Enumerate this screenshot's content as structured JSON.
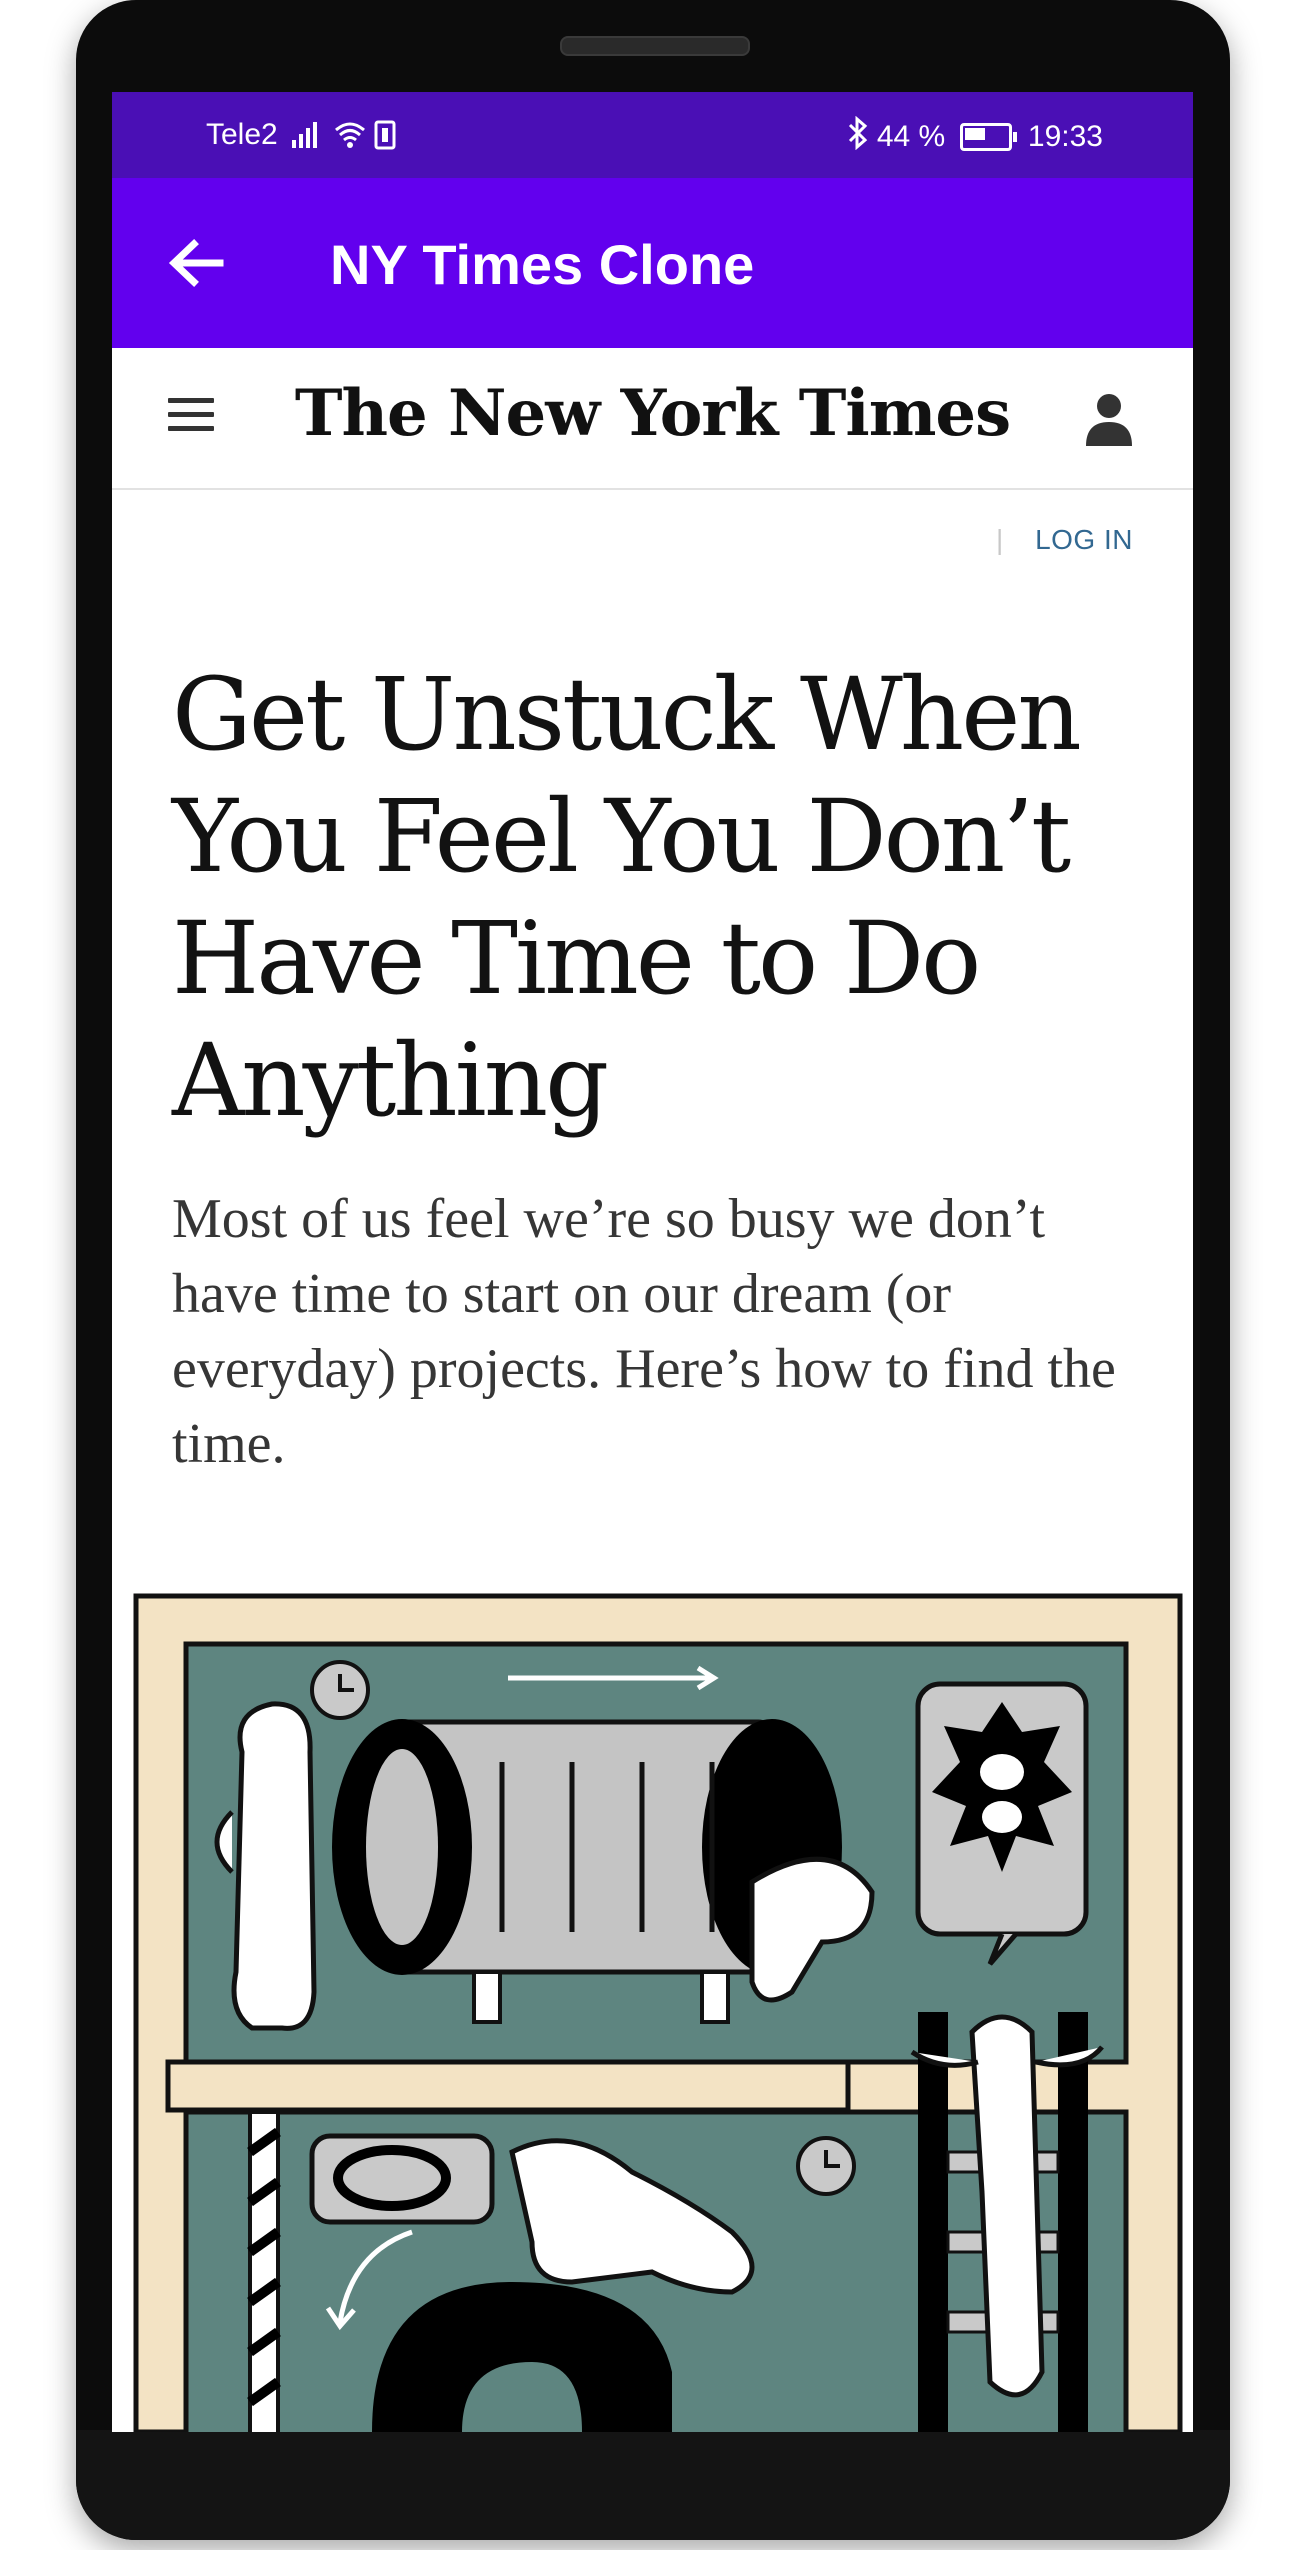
{
  "status_bar": {
    "carrier": "Tele2",
    "battery": "44 %",
    "time": "19:33"
  },
  "app_bar": {
    "title": "NY Times Clone",
    "back_icon": "arrow-back-icon"
  },
  "nyt_header": {
    "logo_text": "The New York Times",
    "menu_icon": "hamburger-menu-icon",
    "account_icon": "person-icon"
  },
  "login": {
    "separator": "|",
    "label": "LOG IN"
  },
  "article": {
    "headline": "Get Unstuck When You Feel You Don’t Have Time to Do Anything",
    "summary": "Most of us feel we’re so busy we don’t have time to start on our dream (or everyday) projects. Here’s how to find the time."
  },
  "colors": {
    "status_bar": "#4a0fb5",
    "app_bar": "#6200ee",
    "link": "#326891",
    "illustration_frame": "#f3e3c4",
    "illustration_teal": "#5e8580"
  }
}
